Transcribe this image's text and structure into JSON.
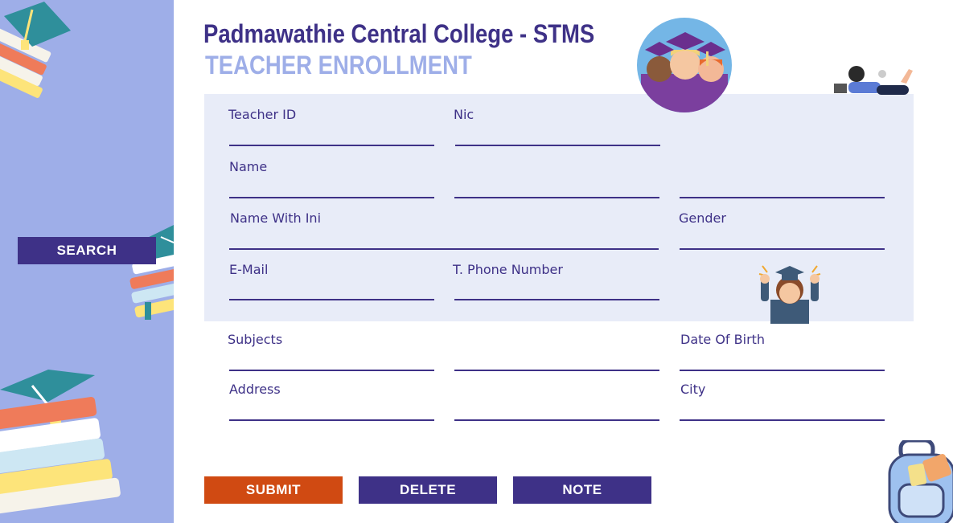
{
  "header": {
    "title": "Padmawathie Central College - STMS",
    "subtitle": "TEACHER ENROLLMENT"
  },
  "sidebar": {
    "search_label": "SEARCH"
  },
  "form": {
    "teacher_id": {
      "label": "Teacher ID",
      "value": ""
    },
    "nic": {
      "label": "Nic",
      "value": ""
    },
    "name": {
      "label": "Name",
      "first": "",
      "middle": "",
      "last": ""
    },
    "name_with_ini": {
      "label": "Name With Ini",
      "value": ""
    },
    "gender": {
      "label": "Gender",
      "value": ""
    },
    "email": {
      "label": "E-Mail",
      "value": ""
    },
    "phone": {
      "label": "T. Phone Number",
      "value": ""
    },
    "subjects": {
      "label": "Subjects",
      "value1": "",
      "value2": ""
    },
    "dob": {
      "label": "Date Of Birth",
      "value": ""
    },
    "address": {
      "label": "Address",
      "value1": "",
      "value2": ""
    },
    "city": {
      "label": "City",
      "value": ""
    }
  },
  "actions": {
    "submit": "SUBMIT",
    "delete": "DELETE",
    "note": "NOTE"
  },
  "colors": {
    "primary": "#3e3187",
    "accent": "#d04a12",
    "sidebar": "#9eaee8",
    "panel": "#e8ecf8"
  },
  "icons": [
    "graduates-illustration",
    "student-laptop-illustration",
    "graduate-girl-illustration",
    "books-stack-illustration",
    "backpack-illustration"
  ]
}
